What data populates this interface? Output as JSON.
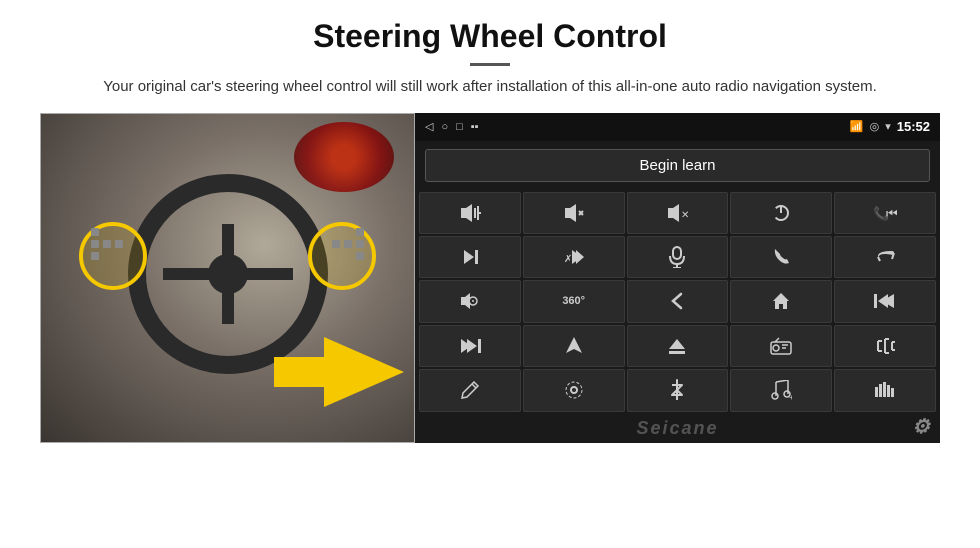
{
  "page": {
    "title": "Steering Wheel Control",
    "subtitle": "Your original car's steering wheel control will still work after installation of this all-in-one auto radio navigation system.",
    "divider": "—"
  },
  "status_bar": {
    "time": "15:52",
    "icons": [
      "◁",
      "○",
      "□",
      "▪▪"
    ]
  },
  "begin_learn_btn": "Begin learn",
  "controls": [
    {
      "icon": "🔊+",
      "label": "vol-up"
    },
    {
      "icon": "🔊−",
      "label": "vol-down"
    },
    {
      "icon": "🔇",
      "label": "mute"
    },
    {
      "icon": "⏻",
      "label": "power"
    },
    {
      "icon": "📞⏮",
      "label": "call-prev"
    },
    {
      "icon": "⏭",
      "label": "next"
    },
    {
      "icon": "⏭✗",
      "label": "skip-fwd"
    },
    {
      "icon": "🎤",
      "label": "mic"
    },
    {
      "icon": "📞",
      "label": "phone"
    },
    {
      "icon": "↩",
      "label": "hang-up"
    },
    {
      "icon": "📢",
      "label": "speaker"
    },
    {
      "icon": "360°",
      "label": "360"
    },
    {
      "icon": "↺",
      "label": "back"
    },
    {
      "icon": "🏠",
      "label": "home"
    },
    {
      "icon": "⏮⏮",
      "label": "prev"
    },
    {
      "icon": "⏭⏭",
      "label": "fast-fwd"
    },
    {
      "icon": "➤",
      "label": "nav"
    },
    {
      "icon": "⏏",
      "label": "eject"
    },
    {
      "icon": "📻",
      "label": "radio"
    },
    {
      "icon": "⚙",
      "label": "settings"
    },
    {
      "icon": "✏",
      "label": "edit"
    },
    {
      "icon": "⊙",
      "label": "circle"
    },
    {
      "icon": "✦",
      "label": "bluetooth"
    },
    {
      "icon": "🎵",
      "label": "music"
    },
    {
      "icon": "▐▌▌",
      "label": "eq"
    }
  ],
  "watermark": "Seicane",
  "colors": {
    "bg_dark": "#1a1a1a",
    "btn_bg": "#2a2a2a",
    "border": "#3a3a3a",
    "text": "#ddd",
    "yellow": "#f5c800"
  }
}
